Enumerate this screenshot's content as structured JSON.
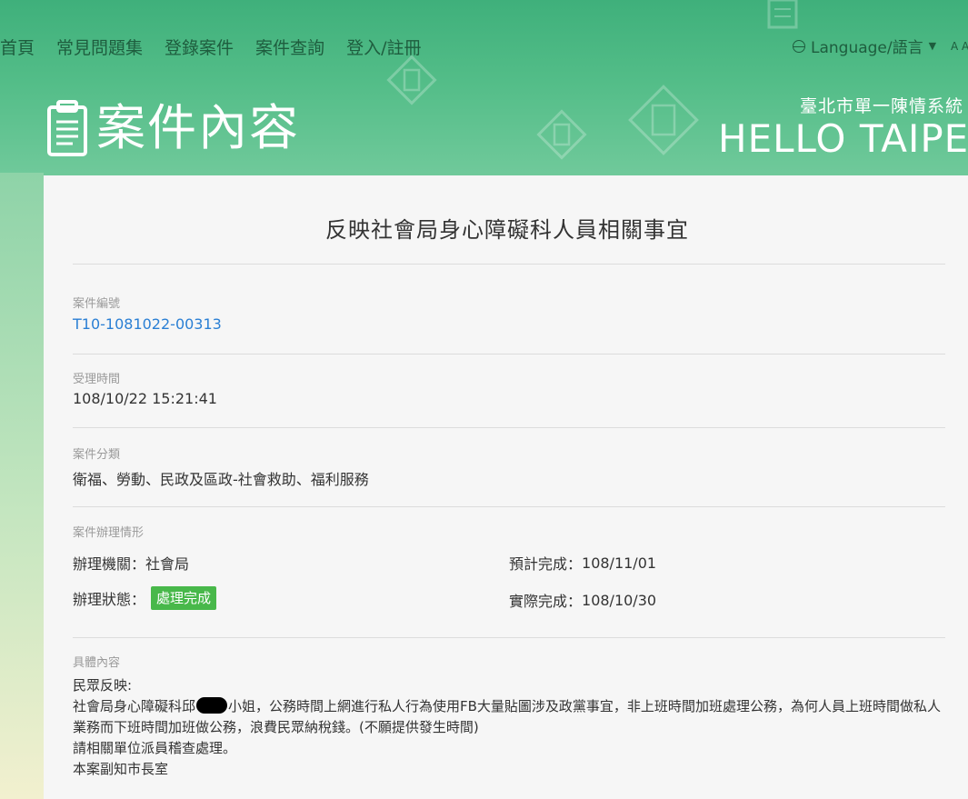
{
  "nav": {
    "items": [
      "首頁",
      "常見問題集",
      "登錄案件",
      "案件查詢",
      "登入/註冊"
    ],
    "language_label": "Language/語言",
    "font_size_label": "A A"
  },
  "header": {
    "page_title": "案件內容",
    "brand_sub": "臺北市單一陳情系統",
    "brand_main": "HELLO TAIPEI"
  },
  "case": {
    "title": "反映社會局身心障礙科人員相關事宜",
    "number_label": "案件編號",
    "number_value": "T10-1081022-00313",
    "accepted_label": "受理時間",
    "accepted_value": "108/10/22 15:21:41",
    "category_label": "案件分類",
    "category_value": "衛福、勞動、民政及區政-社會救助、福利服務",
    "handling_label": "案件辦理情形",
    "agency_label": "辦理機關：",
    "agency_value": "社會局",
    "status_label": "辦理狀態：",
    "status_value": "處理完成",
    "planned_label": "預計完成：",
    "planned_value": "108/11/01",
    "actual_label": "實際完成：",
    "actual_value": "108/10/30",
    "content_label": "具體內容",
    "content_line1": "民眾反映:",
    "content_line2a": "社會局身心障礙科邱",
    "content_line2b": "小姐，公務時間上網進行私人行為使用FB大量貼圖涉及政黨事宜，非上班時間加班處理公務，為何人員上班時間做私人業務而下班時間加班做公務，浪費民眾納稅錢。(不願提供發生時間)",
    "content_line3": "請相關單位派員稽查處理。",
    "content_line4": "本案副知市長室"
  },
  "colors": {
    "header_green": "#4cbd87",
    "link_blue": "#2a7fd4",
    "status_green": "#48b84a"
  }
}
